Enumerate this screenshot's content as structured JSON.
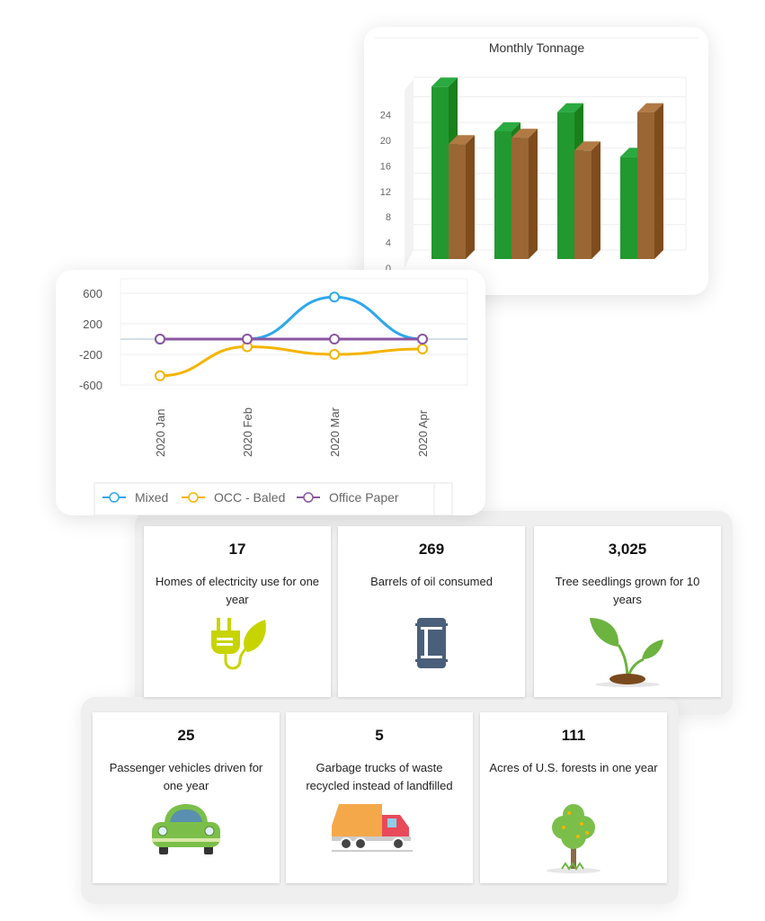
{
  "chart_data": [
    {
      "type": "bar",
      "title": "Monthly Tonnage",
      "categories": [
        "",
        "",
        "",
        ""
      ],
      "series": [
        {
          "color": "#21992f",
          "values": [
            27,
            20,
            23,
            16
          ]
        },
        {
          "color": "#9a6633",
          "values": [
            18,
            19,
            17,
            23
          ]
        }
      ],
      "yticks": [
        "0",
        "4",
        "8",
        "12",
        "16",
        "20",
        "24"
      ],
      "ylim": [
        0,
        28
      ],
      "grid": true
    },
    {
      "type": "line",
      "categories": [
        "2020 Jan",
        "2020 Feb",
        "2020 Mar",
        "2020 Apr"
      ],
      "series": [
        {
          "name": "Mixed",
          "color": "#2fa8ec",
          "values": [
            0,
            0,
            550,
            0
          ]
        },
        {
          "name": "OCC - Baled",
          "color": "#f5b400",
          "values": [
            -480,
            -100,
            -200,
            -130
          ]
        },
        {
          "name": "Office Paper",
          "color": "#8a55a0",
          "values": [
            0,
            0,
            0,
            0
          ]
        }
      ],
      "yticks": [
        "600",
        "200",
        "-200",
        "-600"
      ],
      "ylim": [
        -650,
        650
      ],
      "legend": "bottom",
      "grid": true
    }
  ],
  "stats": [
    {
      "value": "17",
      "label": "Homes of electricity use for one year",
      "icon": "plug-leaf-icon"
    },
    {
      "value": "269",
      "label": "Barrels of oil consumed",
      "icon": "oil-barrel-icon"
    },
    {
      "value": "3,025",
      "label": "Tree seedlings grown for 10 years",
      "icon": "seedling-icon"
    },
    {
      "value": "25",
      "label": "Passenger vehicles driven for one year",
      "icon": "car-icon"
    },
    {
      "value": "5",
      "label": "Garbage trucks of waste recycled instead of landfilled",
      "icon": "garbage-truck-icon"
    },
    {
      "value": "111",
      "label": "Acres of U.S. forests in one year",
      "icon": "tree-icon"
    }
  ]
}
